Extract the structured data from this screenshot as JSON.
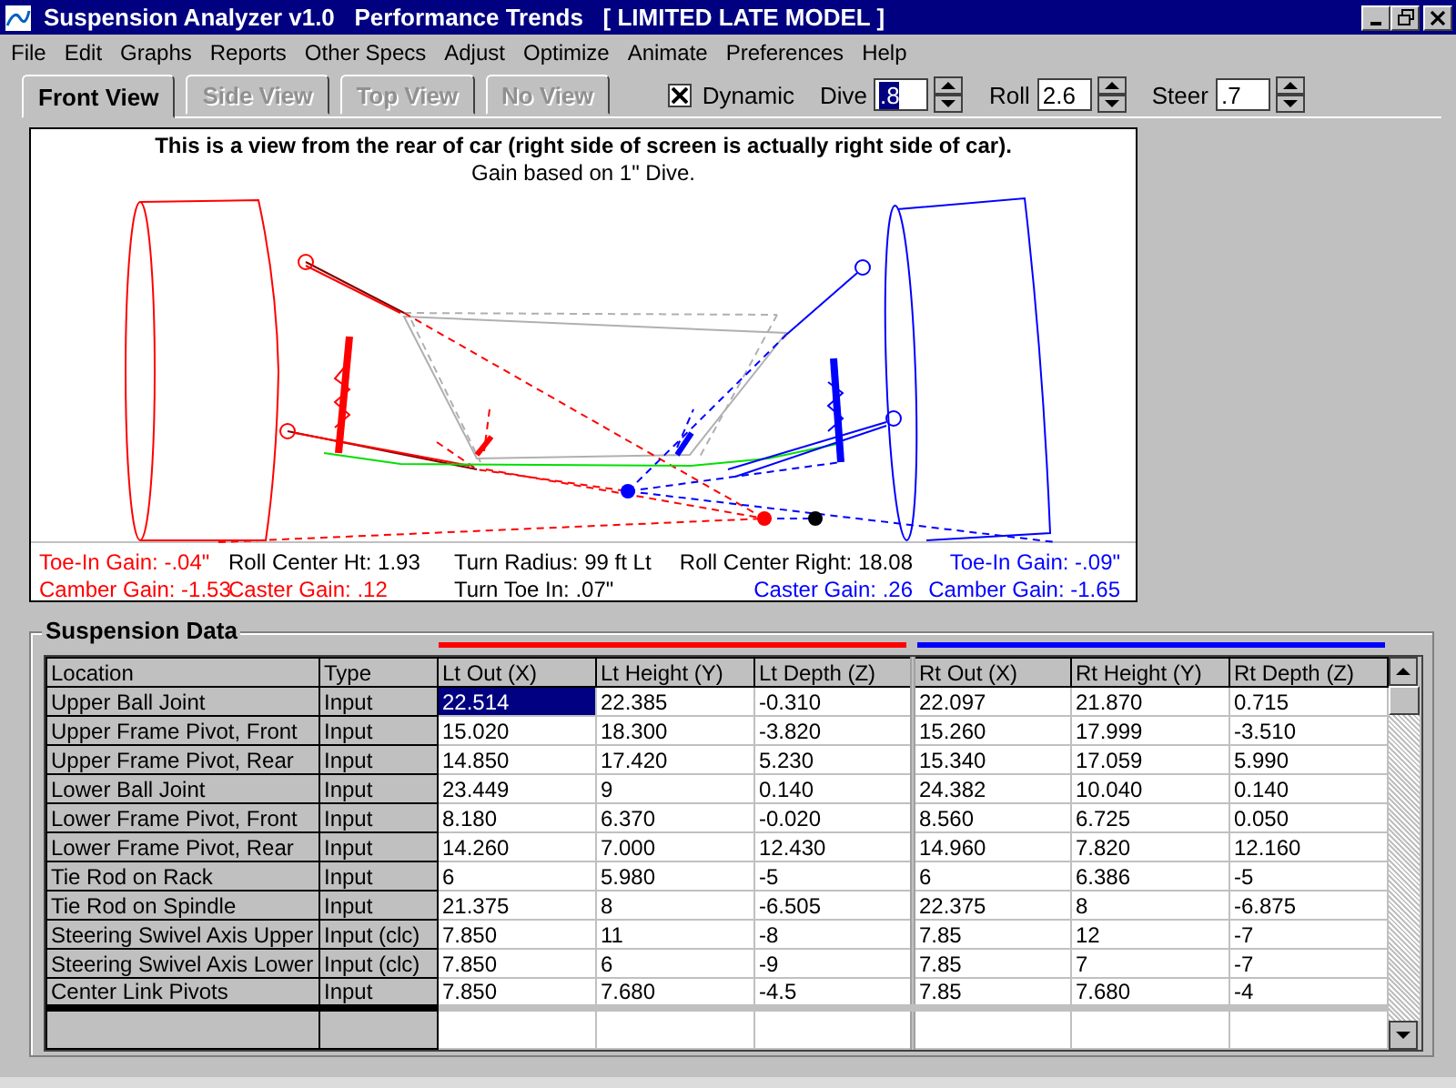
{
  "window": {
    "title": "Suspension Analyzer v1.0   Performance Trends   [ LIMITED LATE MODEL ]"
  },
  "menu": [
    "File",
    "Edit",
    "Graphs",
    "Reports",
    "Other Specs",
    "Adjust",
    "Optimize",
    "Animate",
    "Preferences",
    "Help"
  ],
  "tabs": [
    {
      "label": "Front View",
      "selected": true,
      "disabled": false
    },
    {
      "label": "Side View",
      "selected": false,
      "disabled": true
    },
    {
      "label": "Top View",
      "selected": false,
      "disabled": true
    },
    {
      "label": "No View",
      "selected": false,
      "disabled": true
    }
  ],
  "dynamic": {
    "label": "Dynamic",
    "checked": true
  },
  "spinners": [
    {
      "label": "Dive",
      "value": ".8",
      "selected": true
    },
    {
      "label": "Roll",
      "value": "2.6",
      "selected": false
    },
    {
      "label": "Steer",
      "value": ".7",
      "selected": false
    }
  ],
  "view": {
    "caption": "This is a view from the rear of car (right side of screen is actually right side of car).",
    "subcaption": "Gain based on 1\" Dive.",
    "stats": [
      {
        "text": "Toe-In Gain: -.04\"",
        "color": "#ff0000"
      },
      {
        "text": "Roll Center Ht: 1.93",
        "color": "#000000"
      },
      {
        "text": "Turn Radius: 99 ft Lt",
        "color": "#000000"
      },
      {
        "text": "Roll Center Right: 18.08",
        "color": "#000000"
      },
      {
        "text": "Toe-In Gain: -.09\"",
        "color": "#0000ff"
      },
      {
        "text": "Camber Gain: -1.53",
        "color": "#ff0000"
      },
      {
        "text": "Caster Gain: .12",
        "color": "#ff0000"
      },
      {
        "text": "Turn Toe In: .07\"",
        "color": "#000000"
      },
      {
        "text": "Caster Gain: .26",
        "color": "#0000ff"
      },
      {
        "text": "Camber Gain: -1.65",
        "color": "#0000ff"
      }
    ]
  },
  "table": {
    "title": "Suspension Data",
    "columns": [
      {
        "label": "Location"
      },
      {
        "label": "Type"
      },
      {
        "label": "Lt Out (X)",
        "color": "#ff0000"
      },
      {
        "label": "Lt Height (Y)",
        "color": "#ff0000"
      },
      {
        "label": "Lt Depth (Z)",
        "color": "#ff0000"
      },
      {
        "label": "Rt Out (X)",
        "color": "#0000ff"
      },
      {
        "label": "Rt Height (Y)",
        "color": "#0000ff"
      },
      {
        "label": "Rt Depth (Z)",
        "color": "#0000ff"
      }
    ],
    "rows": [
      {
        "location": "Upper Ball Joint",
        "type": "Input",
        "values": [
          {
            "v": "22.514",
            "selected": true
          },
          {
            "v": "22.385",
            "selected": false
          },
          {
            "v": "-0.310",
            "selected": false
          },
          {
            "v": "22.097",
            "selected": false
          },
          {
            "v": "21.870",
            "selected": false
          },
          {
            "v": "0.715",
            "selected": false
          }
        ]
      },
      {
        "location": "Upper Frame Pivot, Front",
        "type": "Input",
        "values": [
          {
            "v": "15.020",
            "selected": false
          },
          {
            "v": "18.300",
            "selected": false
          },
          {
            "v": "-3.820",
            "selected": false
          },
          {
            "v": "15.260",
            "selected": false
          },
          {
            "v": "17.999",
            "selected": false
          },
          {
            "v": "-3.510",
            "selected": false
          }
        ]
      },
      {
        "location": "Upper Frame Pivot, Rear",
        "type": "Input",
        "values": [
          {
            "v": "14.850",
            "selected": false
          },
          {
            "v": "17.420",
            "selected": false
          },
          {
            "v": "5.230",
            "selected": false
          },
          {
            "v": "15.340",
            "selected": false
          },
          {
            "v": "17.059",
            "selected": false
          },
          {
            "v": "5.990",
            "selected": false
          }
        ]
      },
      {
        "location": "Lower Ball Joint",
        "type": "Input",
        "values": [
          {
            "v": "23.449",
            "selected": false
          },
          {
            "v": "9",
            "selected": false
          },
          {
            "v": "0.140",
            "selected": false
          },
          {
            "v": "24.382",
            "selected": false
          },
          {
            "v": "10.040",
            "selected": false
          },
          {
            "v": "0.140",
            "selected": false
          }
        ]
      },
      {
        "location": "Lower Frame Pivot, Front",
        "type": "Input",
        "values": [
          {
            "v": "8.180",
            "selected": false
          },
          {
            "v": "6.370",
            "selected": false
          },
          {
            "v": "-0.020",
            "selected": false
          },
          {
            "v": "8.560",
            "selected": false
          },
          {
            "v": "6.725",
            "selected": false
          },
          {
            "v": "0.050",
            "selected": false
          }
        ]
      },
      {
        "location": "Lower Frame Pivot, Rear",
        "type": "Input",
        "values": [
          {
            "v": "14.260",
            "selected": false
          },
          {
            "v": "7.000",
            "selected": false
          },
          {
            "v": "12.430",
            "selected": false
          },
          {
            "v": "14.960",
            "selected": false
          },
          {
            "v": "7.820",
            "selected": false
          },
          {
            "v": "12.160",
            "selected": false
          }
        ]
      },
      {
        "location": "Tie Rod on Rack",
        "type": "Input",
        "values": [
          {
            "v": "6",
            "selected": false
          },
          {
            "v": "5.980",
            "selected": false
          },
          {
            "v": "-5",
            "selected": false
          },
          {
            "v": "6",
            "selected": false
          },
          {
            "v": "6.386",
            "selected": false
          },
          {
            "v": "-5",
            "selected": false
          }
        ]
      },
      {
        "location": "Tie Rod on Spindle",
        "type": "Input",
        "values": [
          {
            "v": "21.375",
            "selected": false
          },
          {
            "v": "8",
            "selected": false
          },
          {
            "v": "-6.505",
            "selected": false
          },
          {
            "v": "22.375",
            "selected": false
          },
          {
            "v": "8",
            "selected": false
          },
          {
            "v": "-6.875",
            "selected": false
          }
        ]
      },
      {
        "location": "Steering Swivel Axis Upper",
        "type": "Input (clc)",
        "values": [
          {
            "v": "7.850",
            "selected": false
          },
          {
            "v": "11",
            "selected": false
          },
          {
            "v": "-8",
            "selected": false
          },
          {
            "v": "7.85",
            "selected": false
          },
          {
            "v": "12",
            "selected": false
          },
          {
            "v": "-7",
            "selected": false
          }
        ]
      },
      {
        "location": "Steering Swivel Axis Lower",
        "type": "Input (clc)",
        "values": [
          {
            "v": "7.850",
            "selected": false
          },
          {
            "v": "6",
            "selected": false
          },
          {
            "v": "-9",
            "selected": false
          },
          {
            "v": "7.85",
            "selected": false
          },
          {
            "v": "7",
            "selected": false
          },
          {
            "v": "-7",
            "selected": false
          }
        ]
      },
      {
        "location": "Center Link Pivots",
        "type": "Input",
        "values": [
          {
            "v": "7.850",
            "selected": false
          },
          {
            "v": "7.680",
            "selected": false
          },
          {
            "v": "-4.5",
            "selected": false
          },
          {
            "v": "7.85",
            "selected": false
          },
          {
            "v": "7.680",
            "selected": false
          },
          {
            "v": "-4",
            "selected": false
          }
        ]
      }
    ]
  }
}
